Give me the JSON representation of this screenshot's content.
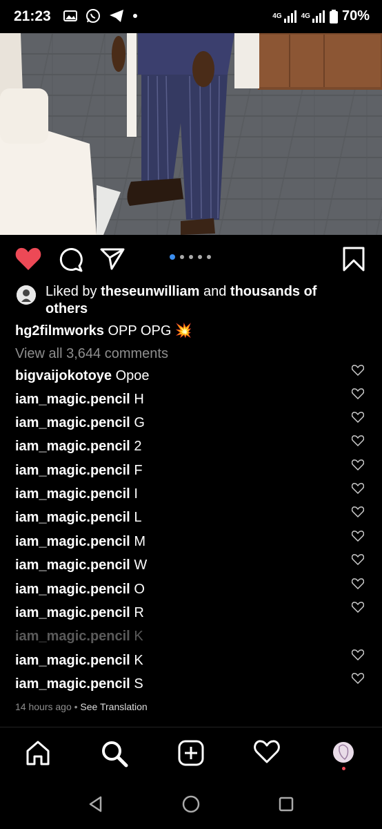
{
  "status_bar": {
    "time": "21:23",
    "network": "4G",
    "battery": "70%"
  },
  "post": {
    "liked_by_prefix": "Liked by ",
    "liked_by_user": "theseunwilliam",
    "liked_by_mid": " and ",
    "liked_by_suffix": "thousands of others",
    "caption_user": "hg2filmworks",
    "caption_text": "OPP OPG 💥",
    "view_all": "View all 3,644 comments",
    "carousel_count": 5,
    "carousel_active": 0,
    "timestamp": "14 hours ago",
    "separator": " • ",
    "see_translation": "See Translation"
  },
  "comments": [
    {
      "user": "bigvaijokotoye",
      "text": "Opoe"
    },
    {
      "user": "iam_magic.pencil",
      "text": "H"
    },
    {
      "user": "iam_magic.pencil",
      "text": "G"
    },
    {
      "user": "iam_magic.pencil",
      "text": "2"
    },
    {
      "user": "iam_magic.pencil",
      "text": "F"
    },
    {
      "user": "iam_magic.pencil",
      "text": "I"
    },
    {
      "user": "iam_magic.pencil",
      "text": "L"
    },
    {
      "user": "iam_magic.pencil",
      "text": "M"
    },
    {
      "user": "iam_magic.pencil",
      "text": "W"
    },
    {
      "user": "iam_magic.pencil",
      "text": "O"
    },
    {
      "user": "iam_magic.pencil",
      "text": "R"
    },
    {
      "user": "iam_magic.pencil",
      "text": "K"
    },
    {
      "user": "iam_magic.pencil",
      "text": "K"
    },
    {
      "user": "iam_magic.pencil",
      "text": "S"
    }
  ],
  "colors": {
    "like_red": "#ed4956",
    "carousel_blue": "#3b8ef0",
    "muted_gray": "#8e8e8e"
  },
  "icons": {
    "like": "heart-filled-icon",
    "comment": "comment-bubble-icon",
    "share": "paper-plane-icon",
    "save": "bookmark-icon",
    "home": "home-icon",
    "search": "search-icon",
    "create": "plus-square-icon",
    "activity": "heart-outline-icon",
    "profile": "profile-avatar"
  }
}
